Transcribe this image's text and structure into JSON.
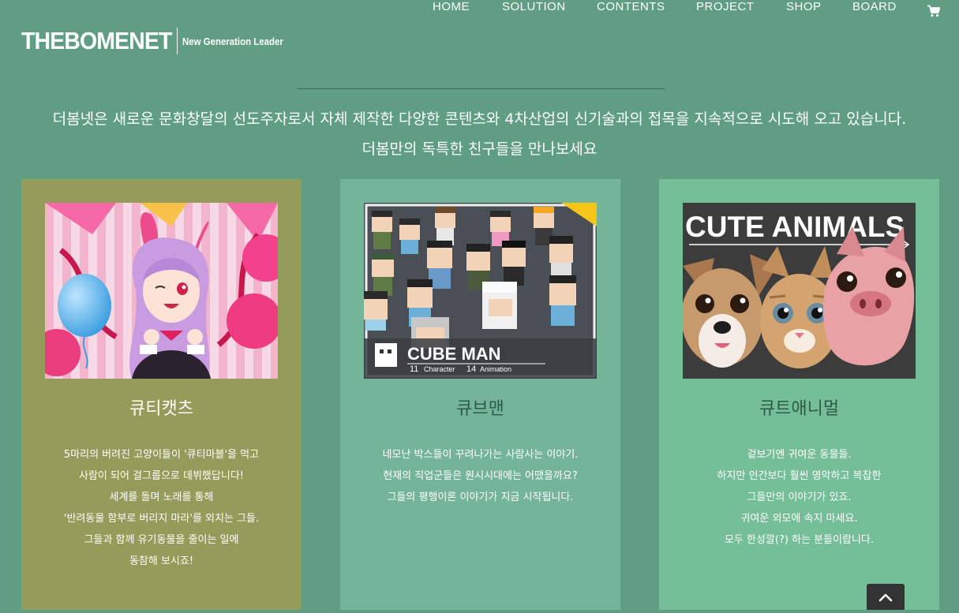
{
  "header": {
    "logo_main": "THEBOMENET",
    "logo_tagline": "New Generation Leader",
    "nav": [
      "HOME",
      "SOLUTION",
      "CONTENTS",
      "PROJECT",
      "SHOP",
      "BOARD"
    ],
    "cart_icon": "shopping-cart-icon"
  },
  "intro": {
    "line1": "더봄넷은 새로운 문화창달의 선도주자로서 자체 제작한 다양한 콘텐츠와 4차산업의 신기술과의 접목을 지속적으로 시도해 오고 있습니다.",
    "line2": "더봄만의 독특한 친구들을 만나보세요"
  },
  "cards": [
    {
      "title": "큐티캣츠",
      "bg_color": "#949c5a",
      "desc": [
        "5마리의 버려진 고양이들이 '큐티마블'을 먹고",
        "사람이 되어 걸그룹으로 데뷔했답니다!",
        "세계를 돌며 노래를 통해",
        "'반려동물 함부로 버리지 마라'를 외치는 그들.",
        "그들과 함께 유기동물을 줄이는 일에",
        "동참해 보시죠!"
      ]
    },
    {
      "title": "큐브맨",
      "bg_color": "#74b499",
      "image_text": {
        "name": "CUBE MAN",
        "stat1_num": "11",
        "stat1_label": "Character",
        "stat2_num": "14",
        "stat2_label": "Animation"
      },
      "desc": [
        "네모난 박스들이 꾸려나가는 사람사는 이야기.",
        "현재의 직업군들은 원시시대에는 어땠을까요?",
        "그들의 평행이론 이야기가 지금 시작됩니다."
      ]
    },
    {
      "title": "큐트애니멀",
      "bg_color": "#74bf97",
      "image_text": {
        "name": "CUTE ANIMALS"
      },
      "desc": [
        "겉보기엔 귀여운 동물들.",
        "하지만 인간보다 훨씬 영악하고 복잡한",
        "그들만의 이야기가 있죠.",
        "귀여운 외모에 속지 마세요.",
        "모두 한성깔(?) 하는 분들이랍니다."
      ]
    }
  ],
  "scroll_top_icon": "chevron-up-icon"
}
